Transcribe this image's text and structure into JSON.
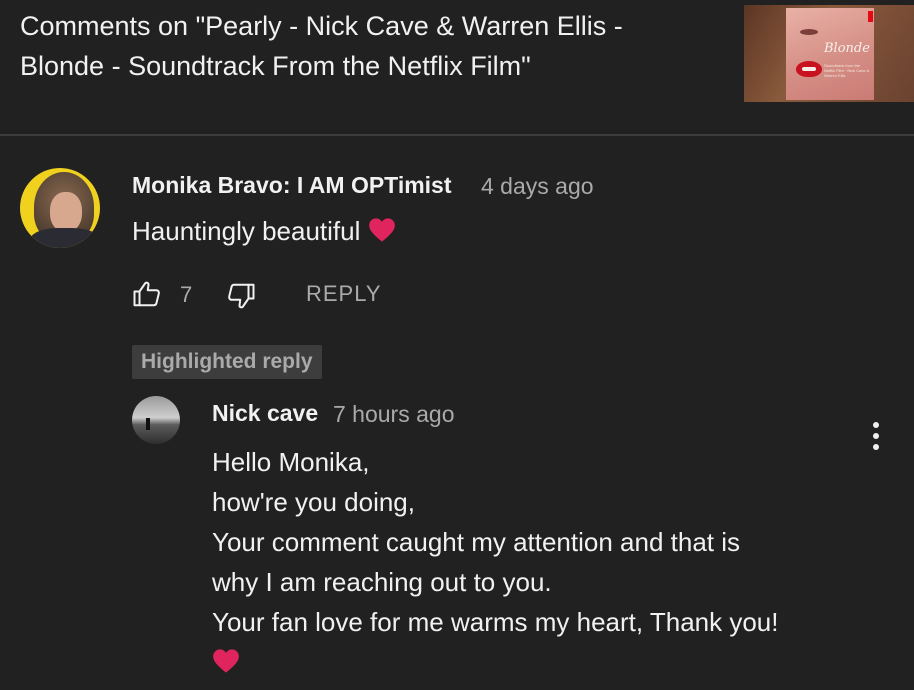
{
  "header": {
    "title_line1": "Comments on \"Pearly - Nick Cave & Warren Ellis -",
    "title_line2": "Blonde - Soundtrack From the Netflix Film\"",
    "thumbnail": {
      "title_text": "Blonde",
      "subtitle_text": "Soundtrack from the Netflix Film · Nick Cave & Warren Ellis"
    }
  },
  "comment": {
    "author": "Monika Bravo: I AM OPTimist",
    "time": "4 days ago",
    "text": "Hauntingly beautiful",
    "likes": "7",
    "reply_label": "REPLY"
  },
  "highlighted_badge": "Highlighted reply",
  "reply": {
    "author": "Nick cave",
    "time": "7 hours ago",
    "lines": [
      "Hello Monika,",
      "how're you doing,",
      "Your comment caught my attention and that is",
      "why I am reaching out to you.",
      "Your fan love for me warms my heart, Thank you!"
    ]
  },
  "icons": {
    "like": "thumbs-up-icon",
    "dislike": "thumbs-down-icon",
    "heart": "red-heart-icon",
    "more": "more-vertical-icon"
  },
  "colors": {
    "background": "#212121",
    "primary_text": "#f1f1f1",
    "secondary_text": "#aaaaaa",
    "badge_bg": "#3d3d3d",
    "heart": "#e0245e"
  }
}
